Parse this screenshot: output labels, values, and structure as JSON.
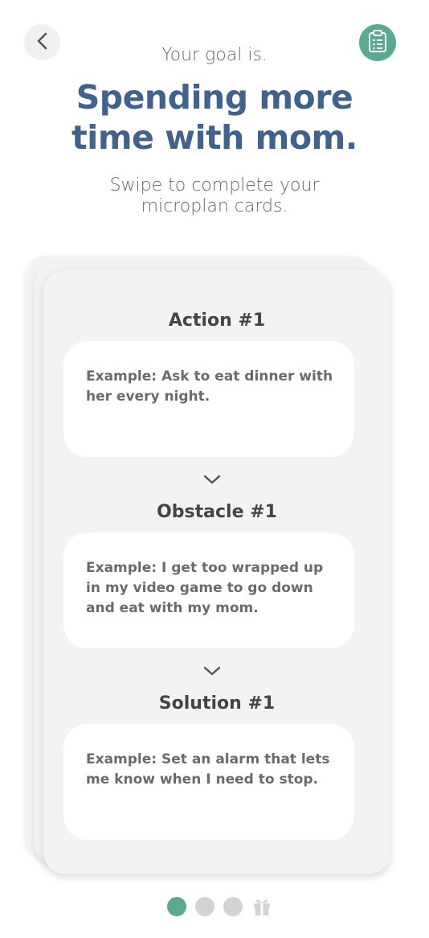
{
  "header": {
    "goal_intro": "Your goal is.",
    "goal_title": "Spending more time with mom.",
    "instruction": "Swipe to complete your microplan cards."
  },
  "card": {
    "sections": [
      {
        "title": "Action #1",
        "text": "Example: Ask to eat dinner with her every night."
      },
      {
        "title": "Obstacle  #1",
        "text": "Example: I get too wrapped up in my video game to go down and eat with my mom."
      },
      {
        "title": "Solution  #1",
        "text": "Example: Set an alarm that lets me know when I need to stop."
      }
    ]
  },
  "pagination": {
    "total_dots": 3,
    "active_index": 0,
    "final_icon": "gift-icon"
  },
  "colors": {
    "accent": "#5aaa91",
    "title": "#41628c",
    "card_bg": "#f2f3f5"
  }
}
